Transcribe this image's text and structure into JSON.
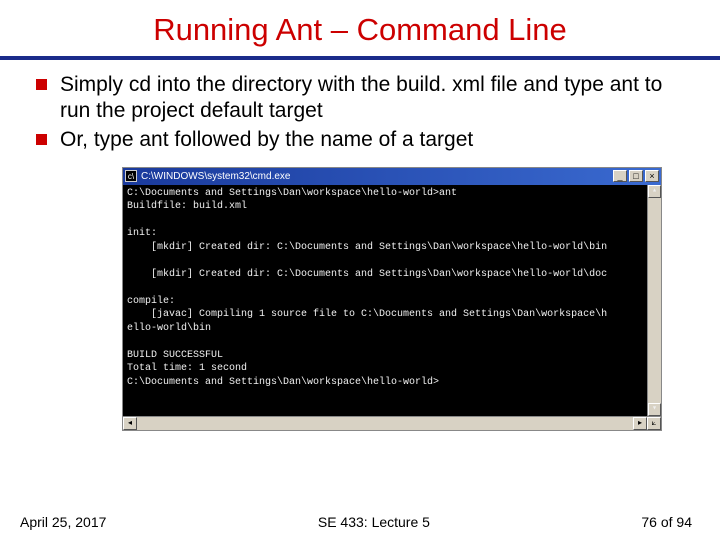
{
  "title": "Running Ant – Command Line",
  "bullets": [
    "Simply cd into the directory with the build. xml file and type ant to run the project default target",
    "Or, type ant followed by the name of a target"
  ],
  "cmd": {
    "title": "C:\\WINDOWS\\system32\\cmd.exe",
    "lines": [
      "C:\\Documents and Settings\\Dan\\workspace\\hello-world>ant",
      "Buildfile: build.xml",
      "",
      "init:",
      "    [mkdir] Created dir: C:\\Documents and Settings\\Dan\\workspace\\hello-world\\bin",
      "",
      "    [mkdir] Created dir: C:\\Documents and Settings\\Dan\\workspace\\hello-world\\doc",
      "",
      "compile:",
      "    [javac] Compiling 1 source file to C:\\Documents and Settings\\Dan\\workspace\\h",
      "ello-world\\bin",
      "",
      "BUILD SUCCESSFUL",
      "Total time: 1 second",
      "C:\\Documents and Settings\\Dan\\workspace\\hello-world>"
    ]
  },
  "footer": {
    "date": "April 25, 2017",
    "course": "SE 433: Lecture 5",
    "page": "76 of 94"
  }
}
